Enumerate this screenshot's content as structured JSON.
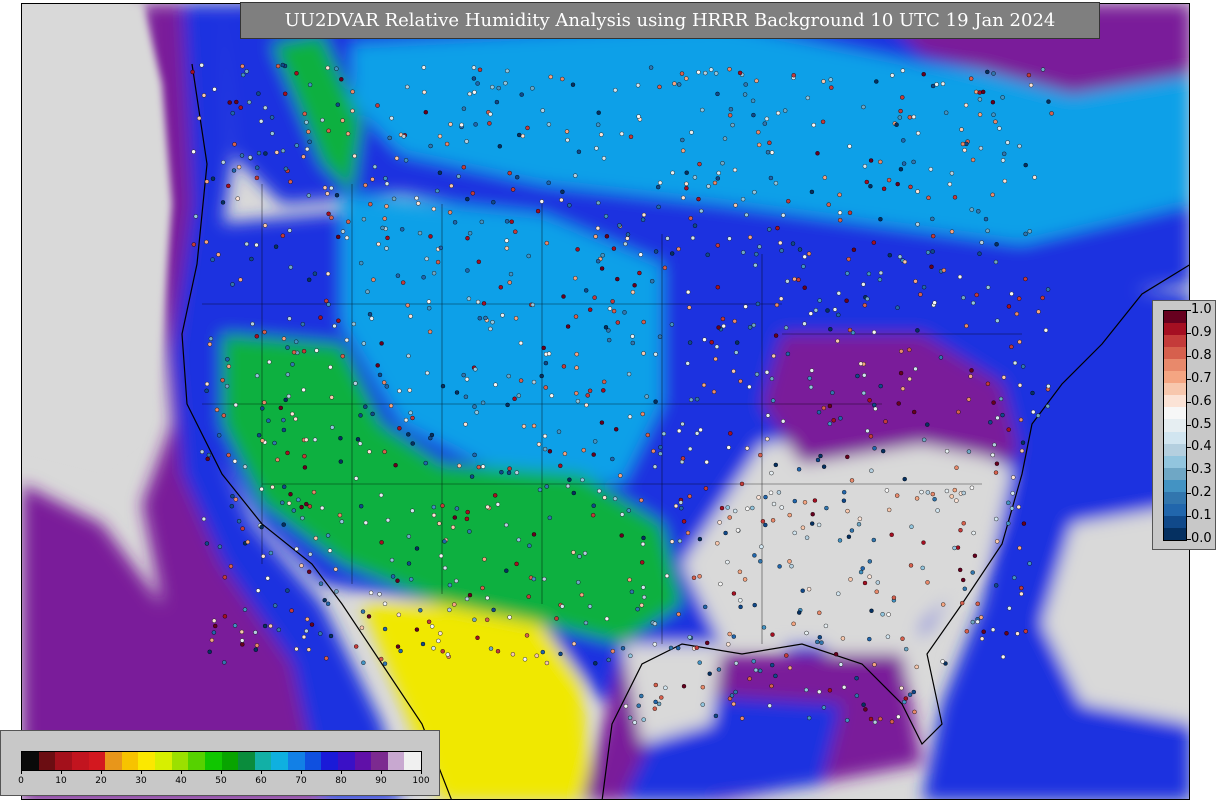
{
  "title": "UU2DVAR Relative Humidity Analysis using HRRR Background 10 UTC 19 Jan 2024",
  "obs_colorbar": {
    "tick_labels": [
      "1.0",
      "0.9",
      "0.8",
      "0.7",
      "0.6",
      "0.5",
      "0.4",
      "0.3",
      "0.2",
      "0.1",
      "0.0"
    ],
    "colors": [
      "#67001f",
      "#a50f22",
      "#c43b3a",
      "#d6604d",
      "#e8896b",
      "#f4a582",
      "#f7c7ad",
      "#fbe3d6",
      "#f7f7f7",
      "#e6eef2",
      "#d1e5f0",
      "#b4cfdf",
      "#92c5de",
      "#6fa7c5",
      "#4393c3",
      "#3276ae",
      "#2166ac",
      "#10498a",
      "#053061"
    ]
  },
  "bg_colorbar": {
    "tick_labels": [
      "0",
      "10",
      "20",
      "30",
      "40",
      "50",
      "60",
      "70",
      "80",
      "90",
      "100"
    ],
    "colors": [
      "#0a0a0a",
      "#6b0d12",
      "#a3101b",
      "#c2141f",
      "#d3181f",
      "#e8961a",
      "#f7c300",
      "#fbe800",
      "#d7ef00",
      "#9be000",
      "#56d200",
      "#10c600",
      "#08a400",
      "#0a8c3c",
      "#12b0a6",
      "#0fb0e0",
      "#1280e6",
      "#0f50e0",
      "#1a1ad8",
      "#3a10c6",
      "#6010a8",
      "#7c2a90",
      "#c8a8d0",
      "#f0f0f0"
    ]
  },
  "map_colors": {
    "ocean_high": "#d9d9d9",
    "purple": "#7a1a9a",
    "blue": "#1a30e0",
    "cyan": "#10a0e8",
    "green": "#10b040",
    "yellow": "#f0e800",
    "coastline": "#000000"
  }
}
